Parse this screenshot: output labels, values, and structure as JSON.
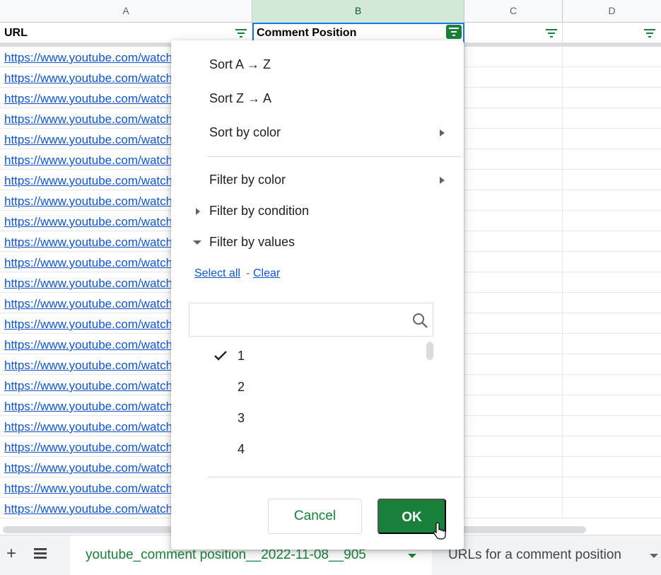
{
  "columns": [
    "A",
    "B",
    "C",
    "D"
  ],
  "header_row": {
    "url": "URL",
    "comment_position": "Comment Position"
  },
  "rows": [
    "https://www.youtube.com/watch?v=",
    "https://www.youtube.com/watch?v=",
    "https://www.youtube.com/watch?v=",
    "https://www.youtube.com/watch?v=",
    "https://www.youtube.com/watch?v=",
    "https://www.youtube.com/watch?v=",
    "https://www.youtube.com/watch?v=",
    "https://www.youtube.com/watch?v=",
    "https://www.youtube.com/watch?v=",
    "https://www.youtube.com/watch?v=",
    "https://www.youtube.com/watch?v=",
    "https://www.youtube.com/watch?v=",
    "https://www.youtube.com/watch?v=",
    "https://www.youtube.com/watch?v=",
    "https://www.youtube.com/watch?v=",
    "https://www.youtube.com/watch?v=",
    "https://www.youtube.com/watch?v=",
    "https://www.youtube.com/watch?v=",
    "https://www.youtube.com/watch?v=",
    "https://www.youtube.com/watch?v=",
    "https://www.youtube.com/watch?v=",
    "https://www.youtube.com/watch?v=",
    "https://www.youtube.com/watch?v="
  ],
  "menu": {
    "sort_az": "Sort A → Z",
    "sort_za": "Sort Z → A",
    "sort_by_color": "Sort by color",
    "filter_by_color": "Filter by color",
    "filter_by_condition": "Filter by condition",
    "filter_by_values": "Filter by values",
    "select_all": "Select all",
    "separator": "-",
    "clear": "Clear",
    "search_placeholder": "",
    "values": [
      "1",
      "2",
      "3",
      "4"
    ],
    "checked_value": "1",
    "cancel": "Cancel",
    "ok": "OK"
  },
  "sheets": {
    "add_icon": "+",
    "active_tab": "youtube_comment position__2022-11-08__905",
    "other_tab": "URLs for a comment position"
  },
  "colors": {
    "accent_green": "#188038",
    "link_blue": "#1155cc",
    "selected_column_header": "#d3e9d7"
  },
  "icons": [
    "filter-icon",
    "search-icon",
    "checkmark-icon",
    "all-sheets-icon",
    "pointer-cursor-icon"
  ]
}
